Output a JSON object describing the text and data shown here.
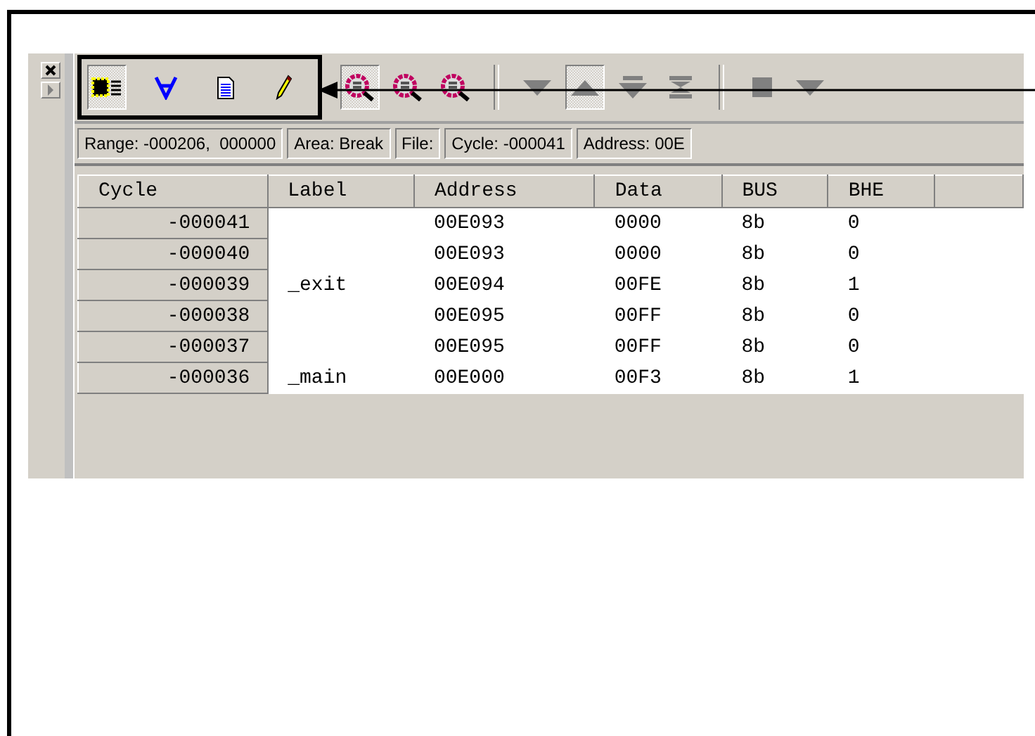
{
  "toolbar": {
    "groups": [
      {
        "outlined": true,
        "items": [
          {
            "kind": "chip",
            "pressed": true
          },
          {
            "kind": "forall",
            "pressed": false
          },
          {
            "kind": "document",
            "pressed": false
          },
          {
            "kind": "pencil",
            "pressed": false
          }
        ]
      },
      {
        "outlined": false,
        "items": [
          {
            "kind": "magnifier",
            "pressed": true
          },
          {
            "kind": "magnifier",
            "pressed": false
          },
          {
            "kind": "magnifier",
            "pressed": false
          }
        ]
      },
      {
        "outlined": false,
        "items": [
          {
            "kind": "down",
            "pressed": false
          },
          {
            "kind": "up",
            "pressed": true
          },
          {
            "kind": "down-bar",
            "pressed": false
          },
          {
            "kind": "both-bar",
            "pressed": false
          }
        ]
      },
      {
        "outlined": false,
        "items": [
          {
            "kind": "square",
            "pressed": false
          },
          {
            "kind": "down",
            "pressed": false
          }
        ]
      }
    ]
  },
  "status_bar": [
    "Range: -000206,  000000",
    "Area: Break",
    "File:",
    "Cycle: -000041",
    "Address: 00E"
  ],
  "table": {
    "columns": [
      "Cycle",
      "Label",
      "Address",
      "Data",
      "BUS",
      "BHE"
    ],
    "rows": [
      {
        "cycle": "-000041",
        "label": "",
        "address": "00E093",
        "data": "0000",
        "bus": "8b",
        "bhe": "0"
      },
      {
        "cycle": "-000040",
        "label": "",
        "address": "00E093",
        "data": "0000",
        "bus": "8b",
        "bhe": "0"
      },
      {
        "cycle": "-000039",
        "label": "_exit",
        "address": "00E094",
        "data": "00FE",
        "bus": "8b",
        "bhe": "1"
      },
      {
        "cycle": "-000038",
        "label": "",
        "address": "00E095",
        "data": "00FF",
        "bus": "8b",
        "bhe": "0"
      },
      {
        "cycle": "-000037",
        "label": "",
        "address": "00E095",
        "data": "00FF",
        "bus": "8b",
        "bhe": "0"
      },
      {
        "cycle": "-000036",
        "label": "_main",
        "address": "00E000",
        "data": "00F3",
        "bus": "8b",
        "bhe": "1"
      }
    ]
  }
}
